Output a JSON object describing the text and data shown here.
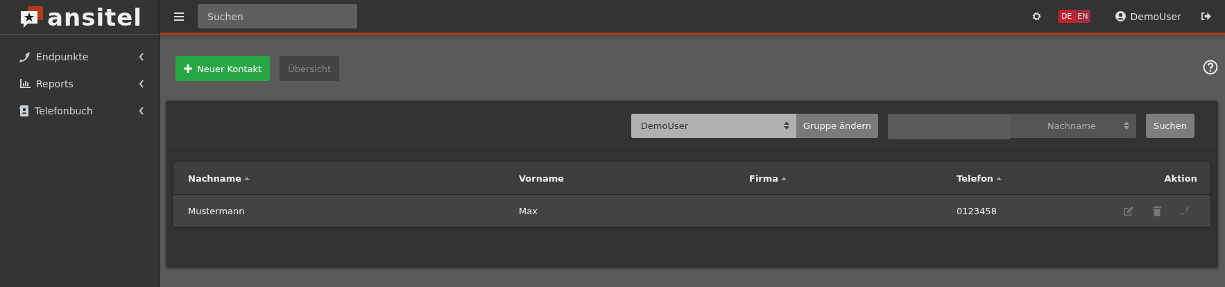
{
  "logo": {
    "text": "ansitel"
  },
  "sidebar": {
    "items": [
      {
        "label": "Endpunkte"
      },
      {
        "label": "Reports"
      },
      {
        "label": "Telefonbuch"
      }
    ]
  },
  "topbar": {
    "search": {
      "placeholder": "Suchen"
    },
    "languages": [
      {
        "label": "DE",
        "selected": true
      },
      {
        "label": "EN",
        "selected": false
      }
    ],
    "user": "DemoUser"
  },
  "toolbar": {
    "buttons": [
      {
        "label": "Neuer Kontakt",
        "kind": "primary",
        "disabled": false
      },
      {
        "label": "Übersicht",
        "kind": "secondary",
        "disabled": true
      }
    ]
  },
  "filters": {
    "group_select": "DemoUser",
    "group_button": "Gruppe ändern",
    "search_field_select": "Nachname",
    "search_button": "Suchen"
  },
  "table": {
    "columns": [
      {
        "label": "Nachname",
        "sortable": true
      },
      {
        "label": "Vorname",
        "sortable": false
      },
      {
        "label": "Firma",
        "sortable": true
      },
      {
        "label": "Telefon",
        "sortable": true
      },
      {
        "label": "Aktion",
        "sortable": false
      }
    ],
    "rows": [
      {
        "cells": [
          "Mustermann",
          "Max",
          "",
          "0123458"
        ]
      }
    ]
  }
}
